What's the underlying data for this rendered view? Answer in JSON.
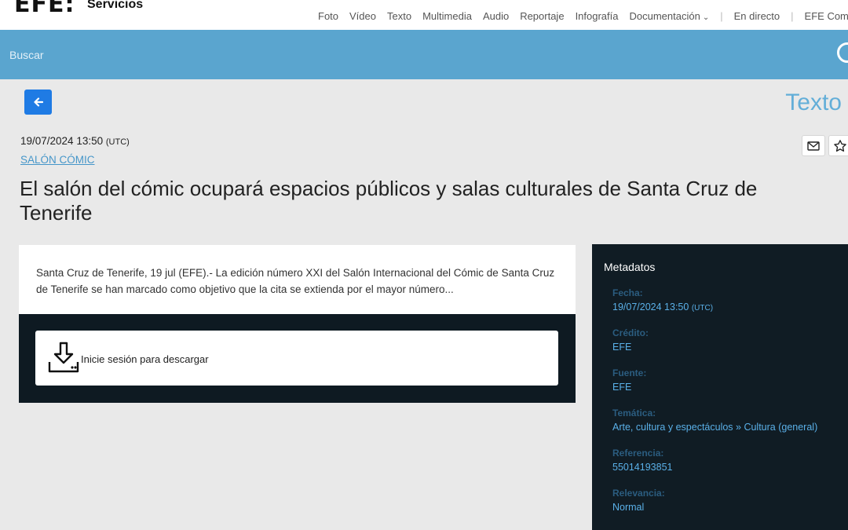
{
  "header": {
    "logo": "EFE:",
    "service": "Servicios",
    "nav": [
      "Foto",
      "Vídeo",
      "Texto",
      "Multimedia",
      "Audio",
      "Reportaje",
      "Infografía",
      "Documentación"
    ],
    "nav_chevron": "⌄",
    "nav_extra": [
      "En directo",
      "EFE Comu"
    ]
  },
  "search": {
    "placeholder": "Buscar"
  },
  "icons": {
    "back": "arrow-left-icon",
    "search": "search-icon",
    "email": "envelope-icon",
    "favorite": "star-icon",
    "download": "download-icon"
  },
  "content": {
    "type_label": "Texto",
    "date": "19/07/2024 13:50",
    "timezone": "(UTC)",
    "category": "SALÓN CÓMIC",
    "title": "El salón del cómic ocupará espacios públicos y salas culturales de Santa Cruz de Tenerife",
    "summary": "Santa Cruz de Tenerife, 19 jul (EFE).- La edición número XXI del Salón Internacional del Cómic de Santa Cruz de Tenerife se han marcado como objetivo que la cita se extienda por el mayor número...",
    "download_text": "Inicie sesión para descargar"
  },
  "metadata": {
    "title": "Metadatos",
    "items": [
      {
        "label": "Fecha:",
        "value": "19/07/2024 13:50",
        "extra": "(UTC)"
      },
      {
        "label": "Crédito:",
        "value": "EFE"
      },
      {
        "label": "Fuente:",
        "value": "EFE"
      },
      {
        "label": "Temática:",
        "value": "Arte, cultura y espectáculos » Cultura (general)"
      },
      {
        "label": "Referencia:",
        "value": "55014193851"
      },
      {
        "label": "Relevancia:",
        "value": "Normal"
      }
    ]
  },
  "colors": {
    "accent": "#5aa5cf",
    "button": "#1f7be4",
    "dark": "#101c24",
    "meta_label": "#2b5d80",
    "meta_value": "#5ab0e8"
  }
}
